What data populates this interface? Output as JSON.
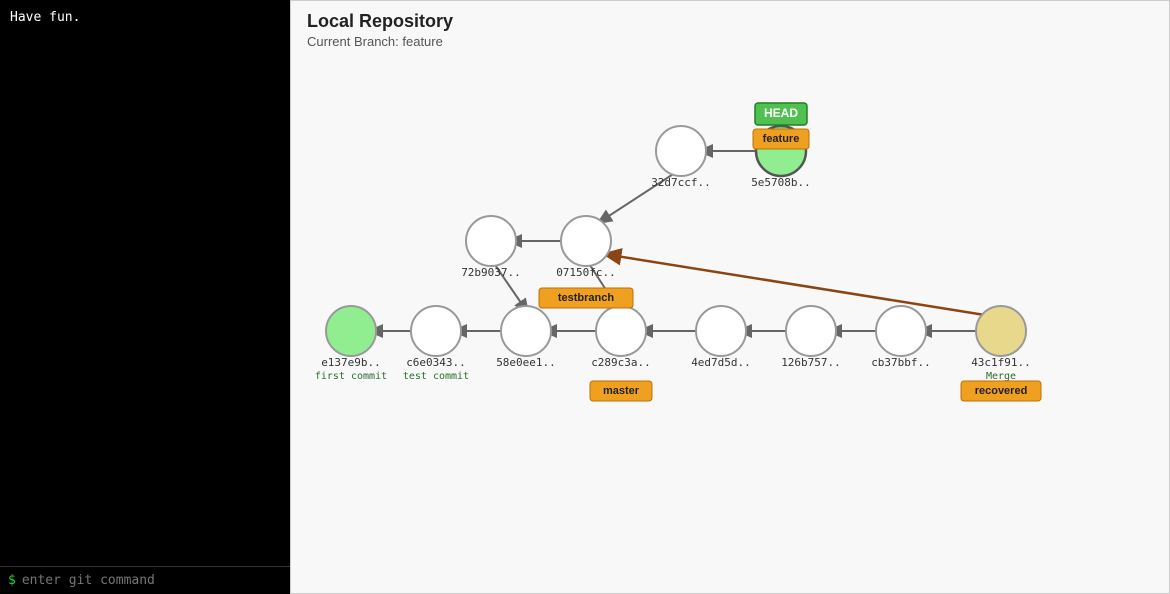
{
  "terminal": {
    "content": "Have fun.",
    "prompt": "$",
    "input_placeholder": "enter git command"
  },
  "repo": {
    "title": "Local Repository",
    "subtitle": "Current Branch: feature",
    "badges": {
      "head": "HEAD",
      "feature": "feature",
      "testbranch": "testbranch",
      "master": "master",
      "recovered": "recovered"
    },
    "commits": [
      {
        "id": "e137e9b..",
        "sub": "first commit"
      },
      {
        "id": "c6e0343..",
        "sub": "test commit"
      },
      {
        "id": "58e0ee1.."
      },
      {
        "id": "c289c3a.."
      },
      {
        "id": "4ed7d5d.."
      },
      {
        "id": "126b757.."
      },
      {
        "id": "cb37bbf.."
      },
      {
        "id": "43c1f91..",
        "sub": "Merge"
      },
      {
        "id": "72b9037.."
      },
      {
        "id": "07150fc.."
      },
      {
        "id": "32d7ccf.."
      },
      {
        "id": "5e5708b.."
      }
    ]
  }
}
